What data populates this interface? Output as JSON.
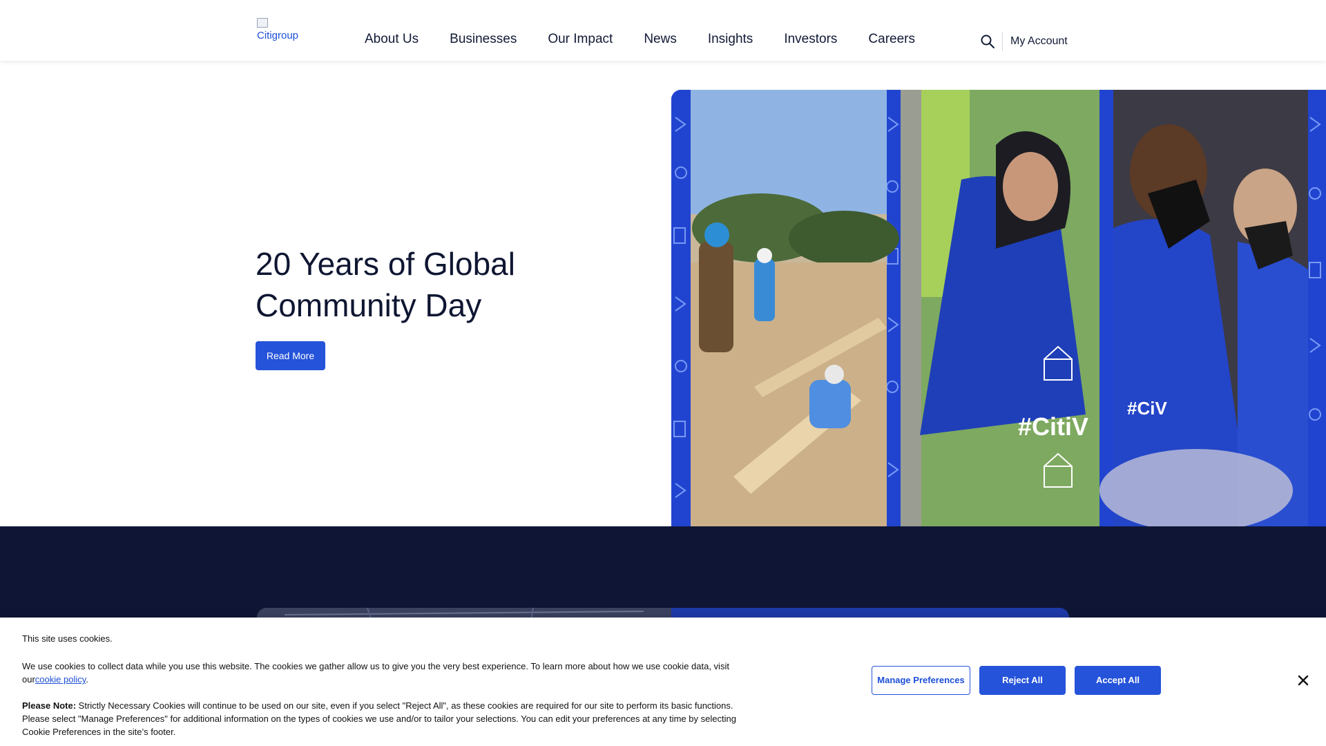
{
  "header": {
    "logo_alt": "Citigroup",
    "nav": [
      "About Us",
      "Businesses",
      "Our Impact",
      "News",
      "Insights",
      "Investors",
      "Careers"
    ],
    "account_label": "My Account"
  },
  "hero": {
    "title": "20 Years of Global Community Day",
    "cta_label": "Read More"
  },
  "cookie_banner": {
    "title": "This site uses cookies.",
    "text_before_link": "We use cookies to collect data while you use this website. The cookies we gather allow us to give you the very best experience. To learn more about how we use cookie data, visit our",
    "link_label": "cookie policy",
    "note_label": "Please Note:",
    "note_text": " Strictly Necessary Cookies will continue to be used on our site, even if you select \"Reject All\", as these cookies are required for our site to perform its basic functions. Please select \"Manage Preferences\" for additional information on the types of cookies we use and/or to tailor your selections. You can edit your preferences at any time by selecting Cookie Preferences in the site’s footer.",
    "buttons": {
      "manage": "Manage Preferences",
      "reject": "Reject All",
      "accept": "Accept All"
    }
  },
  "colors": {
    "brand_blue": "#2553d9",
    "navy": "#0f1635"
  },
  "icons": [
    "search-icon",
    "close-icon"
  ]
}
